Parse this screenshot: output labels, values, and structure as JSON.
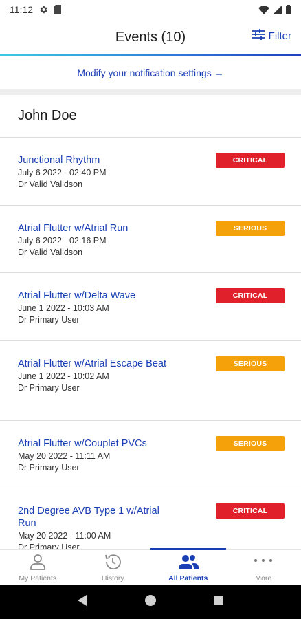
{
  "status_bar": {
    "time": "11:12"
  },
  "header": {
    "title": "Events (10)",
    "filter_label": "Filter"
  },
  "notification_link": "Modify your notification settings →",
  "patient": {
    "name": "John Doe"
  },
  "colors": {
    "accent": "#1a3fb5",
    "critical": "#e0202a",
    "serious": "#f5a20a"
  },
  "events": [
    {
      "name": "Junctional Rhythm",
      "date": "July 6 2022 - 02:40 PM",
      "doctor": "Dr Valid Validson",
      "severity": "CRITICAL",
      "severity_color": "#e0202a"
    },
    {
      "name": "Atrial Flutter w/Atrial Run",
      "date": "July 6 2022 - 02:16 PM",
      "doctor": "Dr Valid Validson",
      "severity": "SERIOUS",
      "severity_color": "#f5a20a"
    },
    {
      "name": "Atrial Flutter w/Delta Wave",
      "date": "June 1 2022 - 10:03 AM",
      "doctor": "Dr Primary User",
      "severity": "CRITICAL",
      "severity_color": "#e0202a"
    },
    {
      "name": "Atrial Flutter w/Atrial Escape Beat",
      "date": "June 1 2022 - 10:02 AM",
      "doctor": "Dr Primary User",
      "severity": "SERIOUS",
      "severity_color": "#f5a20a"
    },
    {
      "name": "Atrial Flutter w/Couplet PVCs",
      "date": "May 20 2022 - 11:11 AM",
      "doctor": "Dr Primary User",
      "severity": "SERIOUS",
      "severity_color": "#f5a20a"
    },
    {
      "name": "2nd Degree AVB Type 1 w/Atrial Run",
      "date": "May 20 2022 - 11:00 AM",
      "doctor": "Dr Primary User",
      "severity": "CRITICAL",
      "severity_color": "#e0202a"
    }
  ],
  "bottom_nav": [
    {
      "label": "My Patients",
      "icon": "person-icon",
      "active": false
    },
    {
      "label": "History",
      "icon": "history-icon",
      "active": false
    },
    {
      "label": "All Patients",
      "icon": "group-icon",
      "active": true
    },
    {
      "label": "More",
      "icon": "more-dots-icon",
      "active": false
    }
  ]
}
